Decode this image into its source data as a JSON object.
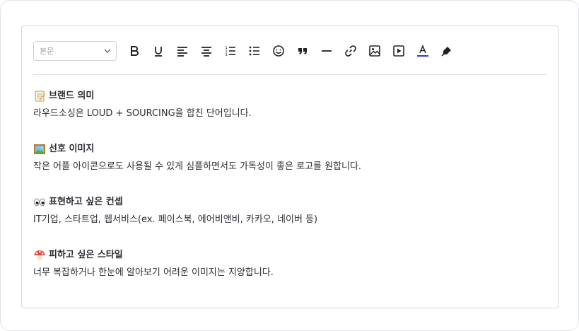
{
  "toolbar": {
    "paragraph_select": {
      "value": "본문"
    },
    "buttons": [
      {
        "name": "bold-button",
        "icon": "bold-icon"
      },
      {
        "name": "underline-button",
        "icon": "underline-icon"
      },
      {
        "name": "align-left-button",
        "icon": "align-left-icon"
      },
      {
        "name": "align-center-button",
        "icon": "align-center-icon"
      },
      {
        "name": "ordered-list-button",
        "icon": "ordered-list-icon"
      },
      {
        "name": "bullet-list-button",
        "icon": "bullet-list-icon"
      },
      {
        "name": "emoji-button",
        "icon": "smiley-icon"
      },
      {
        "name": "quote-button",
        "icon": "quote-icon"
      },
      {
        "name": "horizontal-rule-button",
        "icon": "horizontal-line-icon"
      },
      {
        "name": "link-button",
        "icon": "link-icon"
      },
      {
        "name": "image-button",
        "icon": "image-icon"
      },
      {
        "name": "video-button",
        "icon": "video-play-icon"
      },
      {
        "name": "text-color-button",
        "icon": "text-color-icon"
      },
      {
        "name": "highlight-button",
        "icon": "highlighter-icon"
      }
    ],
    "accent_color": "#2c4bd8"
  },
  "content": {
    "sections": [
      {
        "emoji": "memo-icon",
        "heading": "브랜드 의미",
        "body": "라우드소싱은 LOUD + SOURCING을 합친 단어입니다."
      },
      {
        "emoji": "framed-picture-icon",
        "heading": "선호 이미지",
        "body": "작은 어플 아이콘으로도 사용될 수 있게 심플하면서도 가독성이 좋은 로고를 원합니다."
      },
      {
        "emoji": "eyes-icon",
        "heading": "표현하고 싶은 컨셉",
        "body": "IT기업, 스타트업, 웹서비스(ex. 페이스북, 에어비앤비, 카카오, 네이버 등)"
      },
      {
        "emoji": "mushroom-icon",
        "heading": "피하고 싶은 스타일",
        "body": "너무 복잡하거나 한눈에 알아보기 어려운 이미지는 지양합니다."
      }
    ]
  }
}
